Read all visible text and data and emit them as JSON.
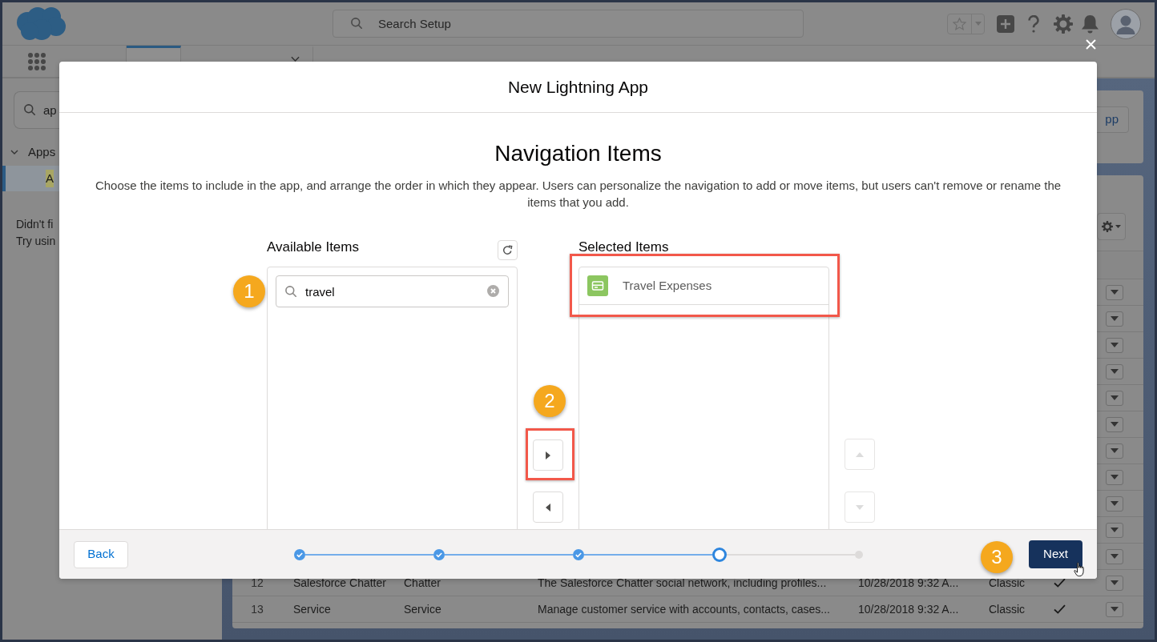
{
  "header": {
    "search": {
      "placeholder": "Search Setup"
    }
  },
  "nav": {
    "tabs": [
      {
        "selected": true
      },
      {
        "selected": false,
        "menu": true
      }
    ]
  },
  "sidebar": {
    "search": {
      "value": "ap"
    },
    "tree": [
      {
        "label": "Apps",
        "expanded": true,
        "selected": false,
        "children": [
          {
            "label": "A",
            "selected": true
          }
        ]
      }
    ],
    "hint_lines": [
      "Didn't fi",
      "Try usin"
    ]
  },
  "top_card": {
    "button": "pp"
  },
  "table": {
    "rows": [
      {},
      {},
      {},
      {},
      {},
      {},
      {},
      {},
      {},
      {},
      {},
      {
        "number": "12",
        "name": "Salesforce Chatter",
        "api_name": "Chatter",
        "description": "The Salesforce Chatter social network, including profiles...",
        "last_modified": "10/28/2018 9:32 A...",
        "type": "Classic",
        "checked": true
      },
      {
        "number": "13",
        "name": "Service",
        "api_name": "Service",
        "description": "Manage customer service with accounts, contacts, cases...",
        "last_modified": "10/28/2018 9:32 A...",
        "type": "Classic",
        "checked": true
      }
    ]
  },
  "modal": {
    "title": "New Lightning App",
    "heading": "Navigation Items",
    "description": "Choose the items to include in the app, and arrange the order in which they appear. Users can personalize the navigation to add or move items, but users can't remove or rename the items that you add.",
    "available": {
      "label": "Available Items",
      "search": {
        "value": "travel"
      }
    },
    "move_buttons": [
      {
        "kind": "right",
        "disabled": false
      },
      {
        "kind": "left",
        "disabled": false
      }
    ],
    "selected": {
      "label": "Selected Items",
      "items": [
        {
          "label": "Travel Expenses"
        }
      ]
    },
    "order_buttons": [
      {
        "kind": "up",
        "disabled": true
      },
      {
        "kind": "down",
        "disabled": true
      }
    ],
    "footer": {
      "back": "Back",
      "steps": [
        {
          "kind": "complete"
        },
        {
          "kind": "complete"
        },
        {
          "kind": "complete"
        },
        {
          "kind": "current"
        },
        {
          "kind": "upcoming"
        }
      ],
      "next": "Next"
    },
    "callouts": [
      {
        "label": "1"
      },
      {
        "label": "2"
      },
      {
        "label": "3"
      }
    ]
  }
}
